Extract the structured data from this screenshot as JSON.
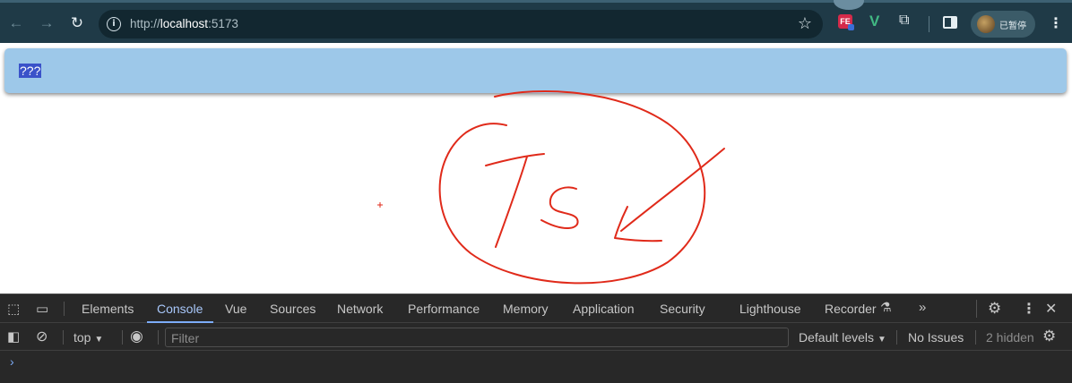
{
  "browser": {
    "url_scheme": "http://",
    "url_host": "localhost",
    "url_port": ":5173",
    "profile_text": "已暂停",
    "extensions": [
      "fe-helper-icon",
      "vue-devtools-icon",
      "puzzle-icon",
      "side-panel-icon"
    ],
    "fe_label": "FE",
    "vue_label": "V"
  },
  "page": {
    "banner_text": "???",
    "banner_color": "#9dc8e9",
    "annotation_text": "Ts",
    "annotation_color": "#e02a1a"
  },
  "devtools": {
    "tabs": [
      {
        "label": "Elements",
        "active": false
      },
      {
        "label": "Console",
        "active": true
      },
      {
        "label": "Vue",
        "active": false
      },
      {
        "label": "Sources",
        "active": false
      },
      {
        "label": "Network",
        "active": false
      },
      {
        "label": "Performance",
        "active": false
      },
      {
        "label": "Memory",
        "active": false
      },
      {
        "label": "Application",
        "active": false
      },
      {
        "label": "Security",
        "active": false
      },
      {
        "label": "Lighthouse",
        "active": false
      },
      {
        "label": "Recorder",
        "active": false
      }
    ],
    "context": "top",
    "filter_placeholder": "Filter",
    "default_levels": "Default levels",
    "issues": "No Issues",
    "hidden": "2 hidden",
    "prompt_symbol": "›"
  }
}
